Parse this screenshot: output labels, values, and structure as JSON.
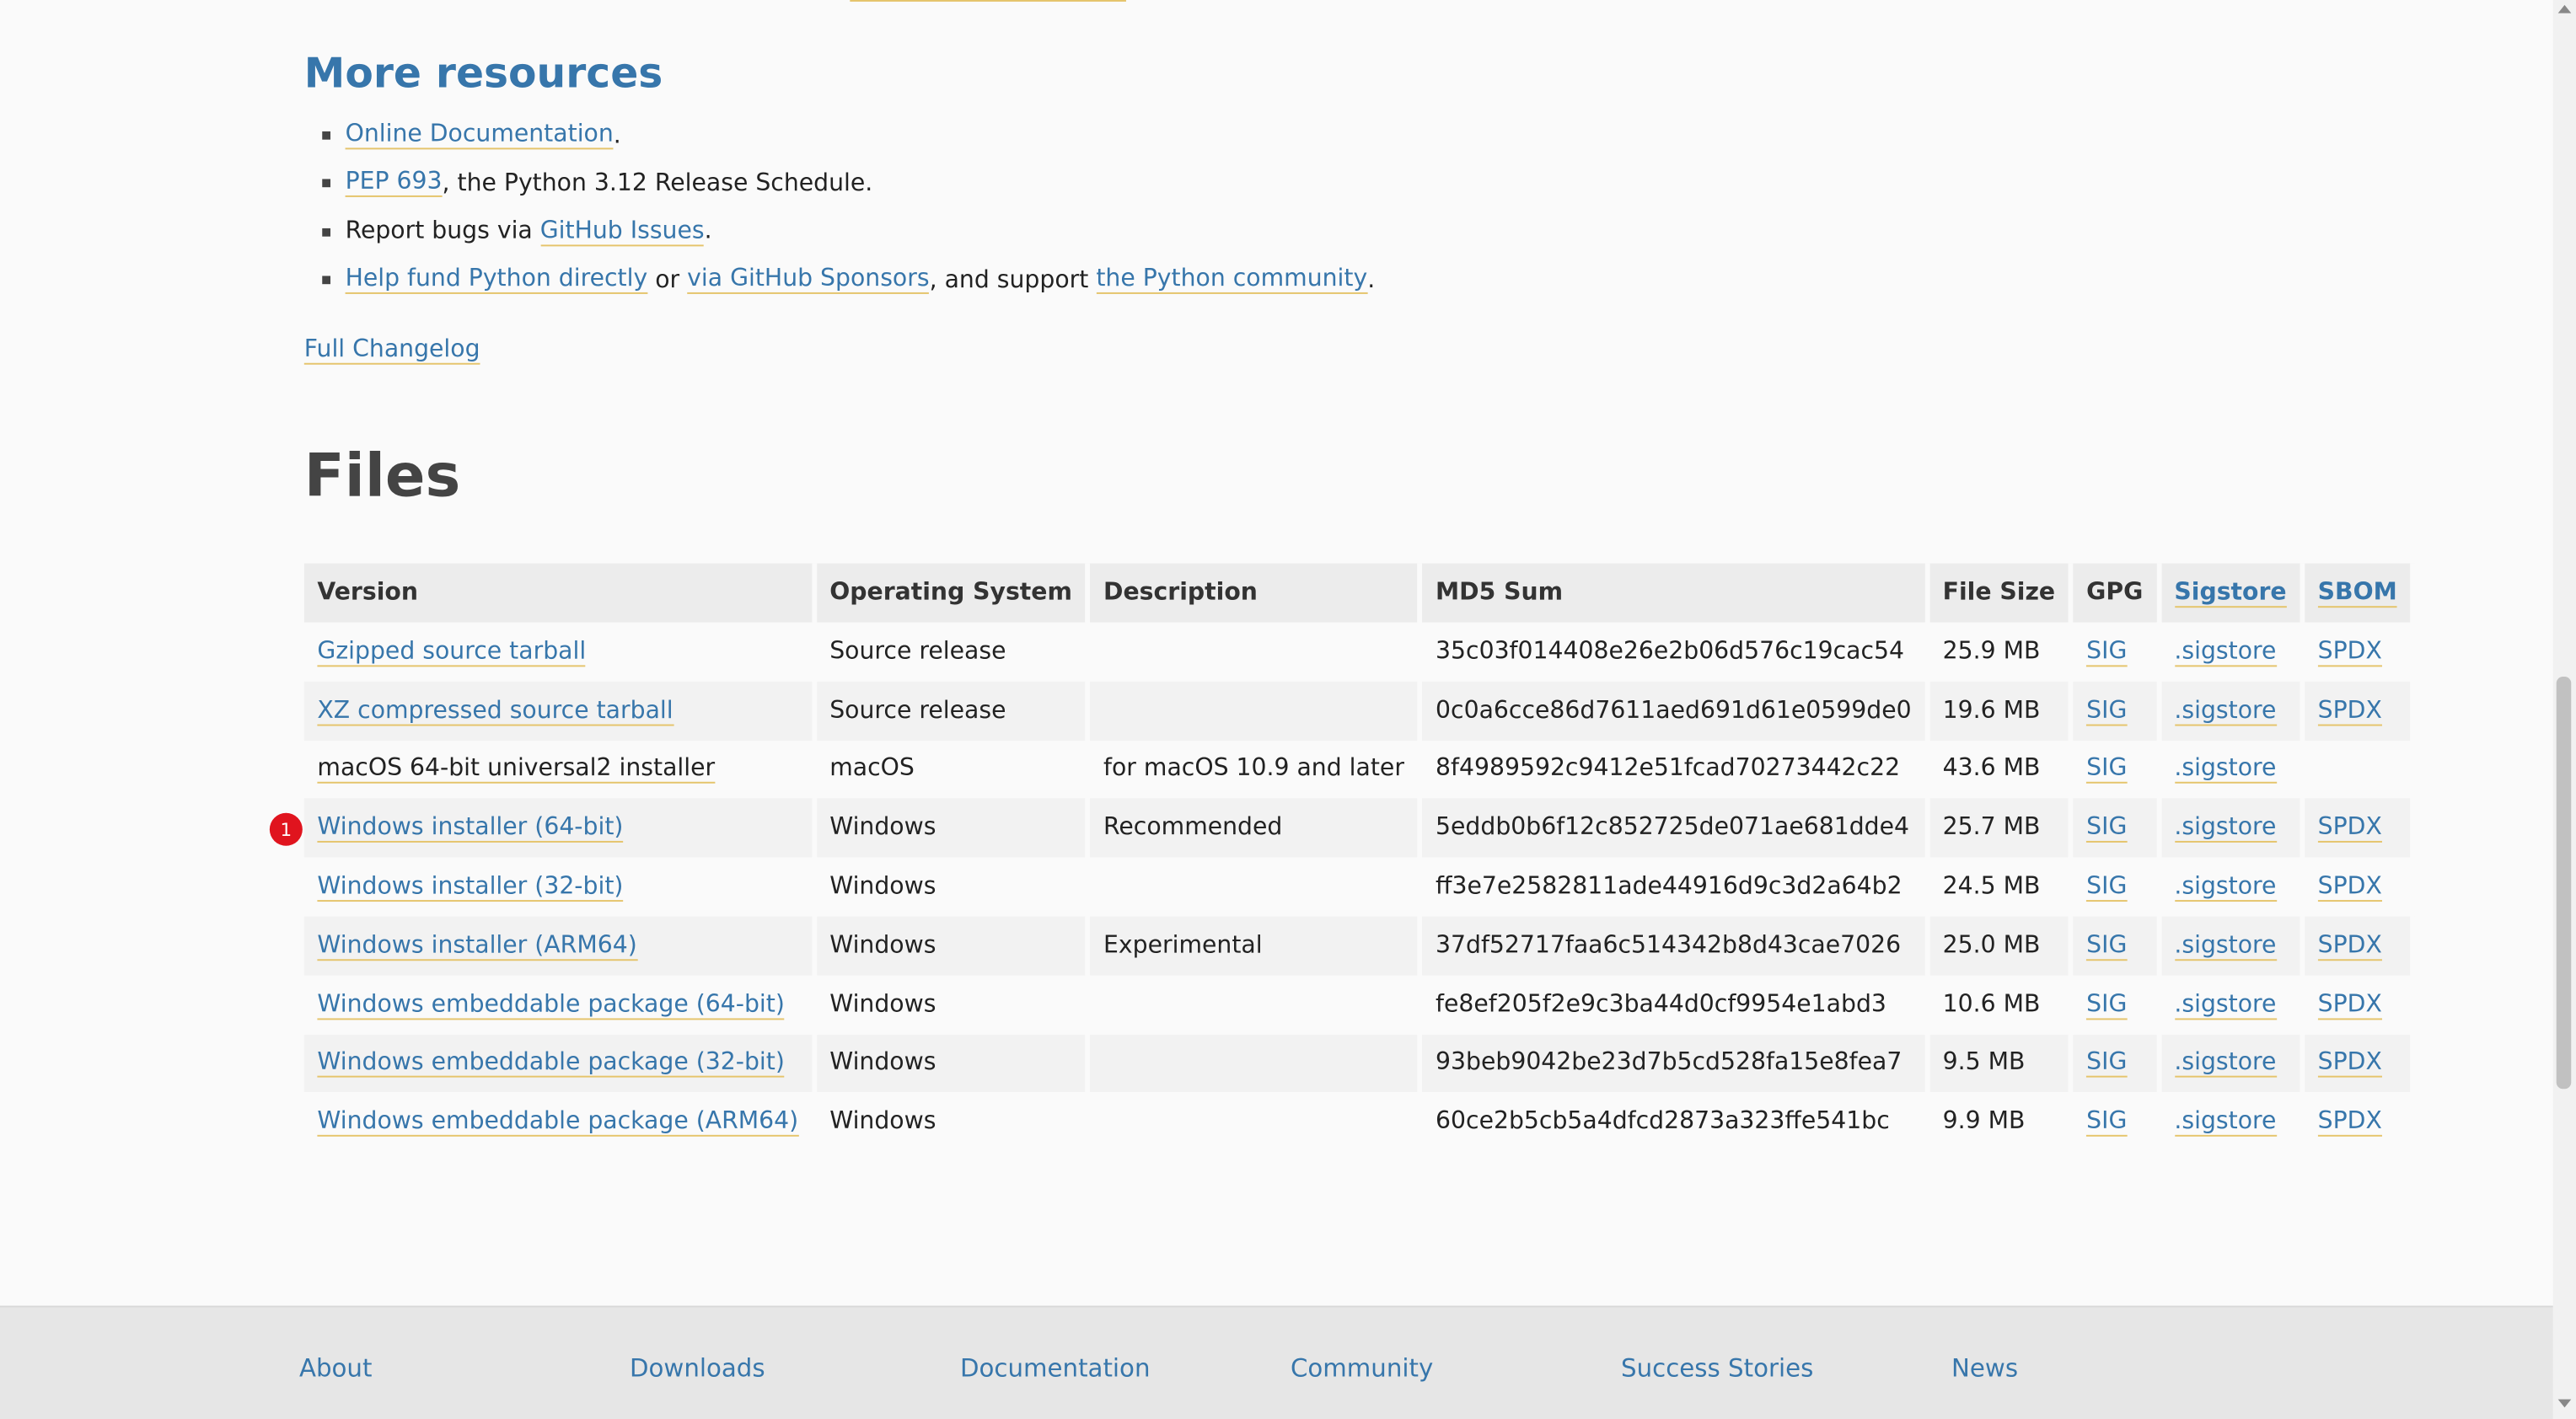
{
  "resources": {
    "heading": "More resources",
    "items": [
      {
        "link1": "Online Documentation",
        "text1": "."
      },
      {
        "link1": "PEP 693",
        "text1": ", the Python 3.12 Release Schedule."
      },
      {
        "prefix": "Report bugs via ",
        "link1": "GitHub Issues",
        "text1": "."
      },
      {
        "link1": "Help fund Python directly",
        "text1": " or ",
        "link2": "via GitHub Sponsors",
        "text2": ", and support ",
        "link3": "the Python community",
        "text3": "."
      }
    ],
    "changelog": "Full Changelog"
  },
  "files": {
    "heading": "Files",
    "columns": [
      "Version",
      "Operating System",
      "Description",
      "MD5 Sum",
      "File Size",
      "GPG",
      "Sigstore",
      "SBOM"
    ],
    "rows": [
      {
        "version": "Gzipped source tarball",
        "os": "Source release",
        "desc": "",
        "md5": "35c03f014408e26e2b06d576c19cac54",
        "size": "25.9 MB",
        "gpg": "SIG",
        "sigstore": ".sigstore",
        "sbom": "SPDX"
      },
      {
        "version": "XZ compressed source tarball",
        "os": "Source release",
        "desc": "",
        "md5": "0c0a6cce86d7611aed691d61e0599de0",
        "size": "19.6 MB",
        "gpg": "SIG",
        "sigstore": ".sigstore",
        "sbom": "SPDX"
      },
      {
        "version": "macOS 64-bit universal2 installer",
        "os": "macOS",
        "desc": "for macOS 10.9 and later",
        "md5": "8f4989592c9412e51fcad70273442c22",
        "size": "43.6 MB",
        "gpg": "SIG",
        "sigstore": ".sigstore",
        "sbom": ""
      },
      {
        "version": "Windows installer (64-bit)",
        "os": "Windows",
        "desc": "Recommended",
        "md5": "5eddb0b6f12c852725de071ae681dde4",
        "size": "25.7 MB",
        "gpg": "SIG",
        "sigstore": ".sigstore",
        "sbom": "SPDX"
      },
      {
        "version": "Windows installer (32-bit)",
        "os": "Windows",
        "desc": "",
        "md5": "ff3e7e2582811ade44916d9c3d2a64b2",
        "size": "24.5 MB",
        "gpg": "SIG",
        "sigstore": ".sigstore",
        "sbom": "SPDX"
      },
      {
        "version": "Windows installer (ARM64)",
        "os": "Windows",
        "desc": "Experimental",
        "md5": "37df52717faa6c514342b8d43cae7026",
        "size": "25.0 MB",
        "gpg": "SIG",
        "sigstore": ".sigstore",
        "sbom": "SPDX"
      },
      {
        "version": "Windows embeddable package (64-bit)",
        "os": "Windows",
        "desc": "",
        "md5": "fe8ef205f2e9c3ba44d0cf9954e1abd3",
        "size": "10.6 MB",
        "gpg": "SIG",
        "sigstore": ".sigstore",
        "sbom": "SPDX"
      },
      {
        "version": "Windows embeddable package (32-bit)",
        "os": "Windows",
        "desc": "",
        "md5": "93beb9042be23d7b5cd528fa15e8fea7",
        "size": "9.5 MB",
        "gpg": "SIG",
        "sigstore": ".sigstore",
        "sbom": "SPDX"
      },
      {
        "version": "Windows embeddable package (ARM64)",
        "os": "Windows",
        "desc": "",
        "md5": "60ce2b5cb5a4dfcd2873a323ffe541bc",
        "size": "9.9 MB",
        "gpg": "SIG",
        "sigstore": ".sigstore",
        "sbom": "SPDX"
      }
    ],
    "badge": "1"
  },
  "footer": {
    "items": [
      "About",
      "Downloads",
      "Documentation",
      "Community",
      "Success Stories",
      "News"
    ]
  },
  "colors": {
    "link": "#3776ab",
    "underline": "#e5c46b",
    "badge": "#e0141e"
  }
}
